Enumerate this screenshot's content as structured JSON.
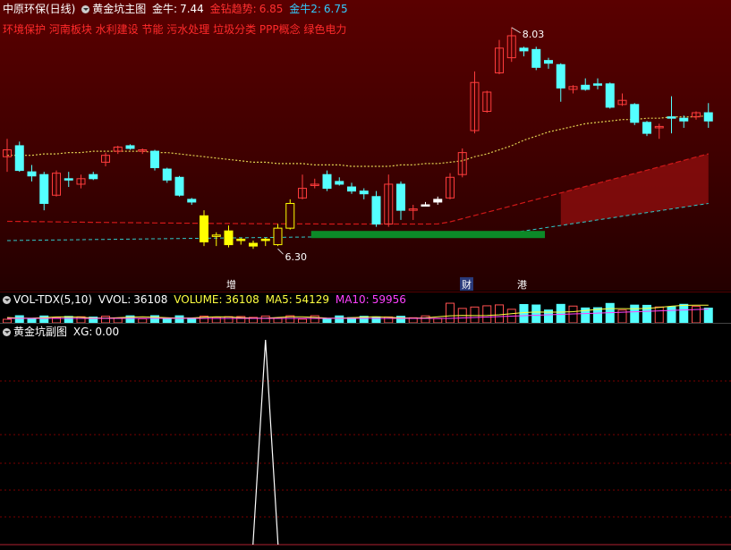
{
  "main": {
    "stock_title": "中原环保(日线)",
    "indicator_title": "黄金坑主图",
    "items": [
      {
        "label": "金牛:",
        "value": "7.44",
        "color": "#ffffff",
        "value_color": "#ffffff"
      },
      {
        "label": "金钻趋势:",
        "value": "6.85",
        "color": "#ff3030",
        "value_color": "#ff3030"
      },
      {
        "label": "金牛2:",
        "value": "6.75",
        "color": "#33ccff",
        "value_color": "#33ccff"
      }
    ],
    "concepts": "环境保护 河南板块 水利建设 节能 污水处理 垃圾分类 PPP概念 绿色电力",
    "high_label": "8.03",
    "low_label": "6.30",
    "markers": [
      {
        "text": "增",
        "color": "#ffffff"
      },
      {
        "text": "财",
        "color": "#ffffff"
      },
      {
        "text": "港",
        "color": "#ffffff"
      }
    ]
  },
  "volume": {
    "title": "VOL-TDX(5,10)",
    "vvol_label": "VVOL:",
    "vvol": "36108",
    "volume_label": "VOLUME:",
    "volume": "36108",
    "ma5_label": "MA5:",
    "ma5": "54129",
    "ma10_label": "MA10:",
    "ma10": "59956"
  },
  "sub": {
    "title": "黄金坑副图",
    "xg_label": "XG:",
    "xg": "0.00"
  },
  "colors": {
    "up": "#ff3c3c",
    "down": "#54ffff",
    "signal": "#ffff00",
    "ma_dotted": "#e0d050",
    "red_line": "#d01818",
    "cyan_line": "#30c8c8"
  },
  "chart_data": {
    "type": "candlestick",
    "y_range": [
      6.2,
      8.1
    ],
    "candles": [
      {
        "o": 7.14,
        "h": 7.22,
        "l": 6.98,
        "c": 7.09,
        "kind": "up"
      },
      {
        "o": 7.17,
        "h": 7.2,
        "l": 6.98,
        "c": 6.99,
        "kind": "down"
      },
      {
        "o": 6.98,
        "h": 7.03,
        "l": 6.91,
        "c": 6.95,
        "kind": "down"
      },
      {
        "o": 6.96,
        "h": 6.98,
        "l": 6.7,
        "c": 6.75,
        "kind": "down"
      },
      {
        "o": 6.81,
        "h": 6.99,
        "l": 6.8,
        "c": 6.97,
        "kind": "up"
      },
      {
        "o": 6.93,
        "h": 6.98,
        "l": 6.87,
        "c": 6.92,
        "kind": "down"
      },
      {
        "o": 6.89,
        "h": 6.96,
        "l": 6.86,
        "c": 6.93,
        "kind": "up"
      },
      {
        "o": 6.96,
        "h": 6.98,
        "l": 6.92,
        "c": 6.93,
        "kind": "down"
      },
      {
        "o": 7.05,
        "h": 7.12,
        "l": 7.02,
        "c": 7.1,
        "kind": "up"
      },
      {
        "o": 7.13,
        "h": 7.17,
        "l": 7.11,
        "c": 7.16,
        "kind": "up"
      },
      {
        "o": 7.17,
        "h": 7.18,
        "l": 7.14,
        "c": 7.15,
        "kind": "down"
      },
      {
        "o": 7.13,
        "h": 7.15,
        "l": 7.11,
        "c": 7.14,
        "kind": "up"
      },
      {
        "o": 7.13,
        "h": 7.14,
        "l": 6.99,
        "c": 7.01,
        "kind": "down"
      },
      {
        "o": 7.0,
        "h": 7.01,
        "l": 6.9,
        "c": 6.92,
        "kind": "down"
      },
      {
        "o": 6.94,
        "h": 6.95,
        "l": 6.8,
        "c": 6.81,
        "kind": "down"
      },
      {
        "o": 6.78,
        "h": 6.79,
        "l": 6.74,
        "c": 6.76,
        "kind": "down"
      },
      {
        "o": 6.66,
        "h": 6.7,
        "l": 6.44,
        "c": 6.47,
        "kind": "signal"
      },
      {
        "o": 6.51,
        "h": 6.54,
        "l": 6.44,
        "c": 6.52,
        "kind": "signal-up"
      },
      {
        "o": 6.55,
        "h": 6.59,
        "l": 6.43,
        "c": 6.45,
        "kind": "signal"
      },
      {
        "o": 6.49,
        "h": 6.5,
        "l": 6.45,
        "c": 6.48,
        "kind": "signal"
      },
      {
        "o": 6.46,
        "h": 6.48,
        "l": 6.42,
        "c": 6.44,
        "kind": "signal"
      },
      {
        "o": 6.49,
        "h": 6.5,
        "l": 6.44,
        "c": 6.48,
        "kind": "signal"
      },
      {
        "o": 6.45,
        "h": 6.6,
        "l": 6.44,
        "c": 6.57,
        "kind": "signal-up"
      },
      {
        "o": 6.57,
        "h": 6.78,
        "l": 6.56,
        "c": 6.75,
        "kind": "signal-up"
      },
      {
        "o": 6.79,
        "h": 6.96,
        "l": 6.78,
        "c": 6.86,
        "kind": "up"
      },
      {
        "o": 6.89,
        "h": 6.93,
        "l": 6.86,
        "c": 6.89,
        "kind": "up"
      },
      {
        "o": 6.96,
        "h": 6.99,
        "l": 6.84,
        "c": 6.86,
        "kind": "down"
      },
      {
        "o": 6.91,
        "h": 6.94,
        "l": 6.88,
        "c": 6.89,
        "kind": "down"
      },
      {
        "o": 6.87,
        "h": 6.9,
        "l": 6.82,
        "c": 6.84,
        "kind": "down"
      },
      {
        "o": 6.84,
        "h": 6.86,
        "l": 6.78,
        "c": 6.82,
        "kind": "down"
      },
      {
        "o": 6.8,
        "h": 6.84,
        "l": 6.58,
        "c": 6.6,
        "kind": "down"
      },
      {
        "o": 6.6,
        "h": 6.96,
        "l": 6.58,
        "c": 6.89,
        "kind": "up"
      },
      {
        "o": 6.89,
        "h": 6.91,
        "l": 6.63,
        "c": 6.7,
        "kind": "down"
      },
      {
        "o": 6.71,
        "h": 6.74,
        "l": 6.63,
        "c": 6.7,
        "kind": "up"
      },
      {
        "o": 6.74,
        "h": 6.76,
        "l": 6.73,
        "c": 6.74,
        "kind": "doji"
      },
      {
        "o": 6.76,
        "h": 6.8,
        "l": 6.74,
        "c": 6.78,
        "kind": "doji"
      },
      {
        "o": 6.79,
        "h": 6.97,
        "l": 6.78,
        "c": 6.94,
        "kind": "up"
      },
      {
        "o": 6.96,
        "h": 7.15,
        "l": 6.94,
        "c": 7.12,
        "kind": "up"
      },
      {
        "o": 7.28,
        "h": 7.71,
        "l": 7.26,
        "c": 7.63,
        "kind": "up"
      },
      {
        "o": 7.42,
        "h": 7.57,
        "l": 7.41,
        "c": 7.56,
        "kind": "up"
      },
      {
        "o": 7.7,
        "h": 7.94,
        "l": 7.69,
        "c": 7.88,
        "kind": "up"
      },
      {
        "o": 7.81,
        "h": 8.03,
        "l": 7.78,
        "c": 7.97,
        "kind": "up"
      },
      {
        "o": 7.88,
        "h": 7.89,
        "l": 7.82,
        "c": 7.86,
        "kind": "down"
      },
      {
        "o": 7.87,
        "h": 7.89,
        "l": 7.72,
        "c": 7.74,
        "kind": "down"
      },
      {
        "o": 7.79,
        "h": 7.81,
        "l": 7.73,
        "c": 7.77,
        "kind": "down"
      },
      {
        "o": 7.76,
        "h": 7.77,
        "l": 7.49,
        "c": 7.59,
        "kind": "down"
      },
      {
        "o": 7.6,
        "h": 7.61,
        "l": 7.55,
        "c": 7.58,
        "kind": "up"
      },
      {
        "o": 7.61,
        "h": 7.66,
        "l": 7.57,
        "c": 7.58,
        "kind": "down"
      },
      {
        "o": 7.61,
        "h": 7.66,
        "l": 7.58,
        "c": 7.62,
        "kind": "down"
      },
      {
        "o": 7.62,
        "h": 7.63,
        "l": 7.44,
        "c": 7.45,
        "kind": "down"
      },
      {
        "o": 7.47,
        "h": 7.55,
        "l": 7.46,
        "c": 7.5,
        "kind": "up"
      },
      {
        "o": 7.47,
        "h": 7.48,
        "l": 7.32,
        "c": 7.34,
        "kind": "down"
      },
      {
        "o": 7.34,
        "h": 7.35,
        "l": 7.24,
        "c": 7.26,
        "kind": "down"
      },
      {
        "o": 7.3,
        "h": 7.33,
        "l": 7.22,
        "c": 7.31,
        "kind": "up"
      },
      {
        "o": 7.38,
        "h": 7.53,
        "l": 7.26,
        "c": 7.37,
        "kind": "down"
      },
      {
        "o": 7.37,
        "h": 7.39,
        "l": 7.3,
        "c": 7.35,
        "kind": "down"
      },
      {
        "o": 7.38,
        "h": 7.42,
        "l": 7.36,
        "c": 7.41,
        "kind": "up"
      },
      {
        "o": 7.41,
        "h": 7.48,
        "l": 7.3,
        "c": 7.35,
        "kind": "down"
      }
    ],
    "ma_dotted": [
      7.1,
      7.1,
      7.1,
      7.11,
      7.11,
      7.12,
      7.12,
      7.13,
      7.13,
      7.13,
      7.13,
      7.13,
      7.12,
      7.12,
      7.11,
      7.1,
      7.09,
      7.08,
      7.07,
      7.06,
      7.05,
      7.05,
      7.04,
      7.04,
      7.04,
      7.03,
      7.03,
      7.03,
      7.02,
      7.02,
      7.02,
      7.02,
      7.03,
      7.03,
      7.04,
      7.04,
      7.05,
      7.06,
      7.09,
      7.11,
      7.14,
      7.17,
      7.21,
      7.24,
      7.27,
      7.29,
      7.31,
      7.33,
      7.34,
      7.35,
      7.36,
      7.36,
      7.37,
      7.37,
      7.38,
      7.38,
      7.38,
      7.39
    ],
    "sub_xg_peak_index": 21
  }
}
